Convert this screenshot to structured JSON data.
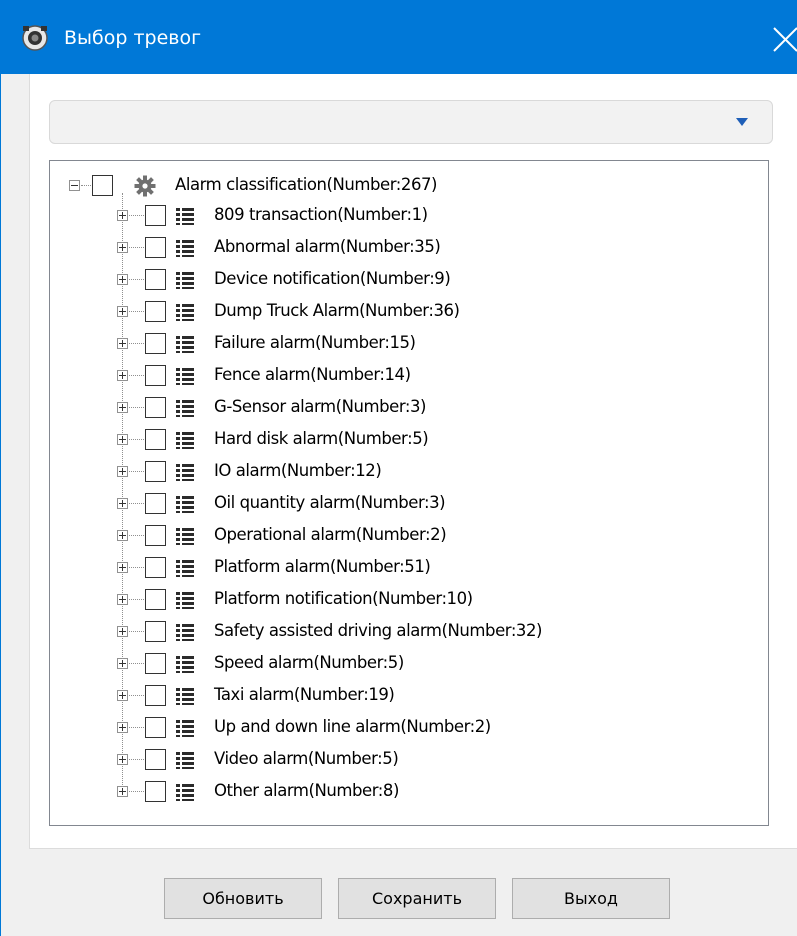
{
  "window": {
    "title": "Выбор тревог",
    "title_bar_color": "#0078d7",
    "app_icon": "camera-app-icon",
    "close_icon": "close-icon"
  },
  "filter": {
    "selected_value": ""
  },
  "tree": {
    "root": {
      "label": "Alarm classification(Number:267)",
      "icon": "gear-icon",
      "expanded": true,
      "checked": false
    },
    "children": [
      {
        "label": "809 transaction(Number:1)",
        "checked": false,
        "expanded": false,
        "icon": "list-icon"
      },
      {
        "label": "Abnormal alarm(Number:35)",
        "checked": false,
        "expanded": false,
        "icon": "list-icon"
      },
      {
        "label": "Device notification(Number:9)",
        "checked": false,
        "expanded": false,
        "icon": "list-icon"
      },
      {
        "label": "Dump Truck Alarm(Number:36)",
        "checked": false,
        "expanded": false,
        "icon": "list-icon"
      },
      {
        "label": "Failure alarm(Number:15)",
        "checked": false,
        "expanded": false,
        "icon": "list-icon"
      },
      {
        "label": "Fence alarm(Number:14)",
        "checked": false,
        "expanded": false,
        "icon": "list-icon"
      },
      {
        "label": "G-Sensor alarm(Number:3)",
        "checked": false,
        "expanded": false,
        "icon": "list-icon"
      },
      {
        "label": "Hard disk alarm(Number:5)",
        "checked": false,
        "expanded": false,
        "icon": "list-icon"
      },
      {
        "label": "IO alarm(Number:12)",
        "checked": false,
        "expanded": false,
        "icon": "list-icon"
      },
      {
        "label": "Oil quantity alarm(Number:3)",
        "checked": false,
        "expanded": false,
        "icon": "list-icon"
      },
      {
        "label": "Operational alarm(Number:2)",
        "checked": false,
        "expanded": false,
        "icon": "list-icon"
      },
      {
        "label": "Platform alarm(Number:51)",
        "checked": false,
        "expanded": false,
        "icon": "list-icon"
      },
      {
        "label": "Platform notification(Number:10)",
        "checked": false,
        "expanded": false,
        "icon": "list-icon"
      },
      {
        "label": "Safety assisted driving alarm(Number:32)",
        "checked": false,
        "expanded": false,
        "icon": "list-icon"
      },
      {
        "label": "Speed alarm(Number:5)",
        "checked": false,
        "expanded": false,
        "icon": "list-icon"
      },
      {
        "label": "Taxi alarm(Number:19)",
        "checked": false,
        "expanded": false,
        "icon": "list-icon"
      },
      {
        "label": "Up and down line alarm(Number:2)",
        "checked": false,
        "expanded": false,
        "icon": "list-icon"
      },
      {
        "label": "Video alarm(Number:5)",
        "checked": false,
        "expanded": false,
        "icon": "list-icon"
      },
      {
        "label": "Other alarm(Number:8)",
        "checked": false,
        "expanded": false,
        "icon": "list-icon"
      }
    ]
  },
  "buttons": {
    "refresh_label": "Обновить",
    "save_label": "Сохранить",
    "exit_label": "Выход"
  }
}
